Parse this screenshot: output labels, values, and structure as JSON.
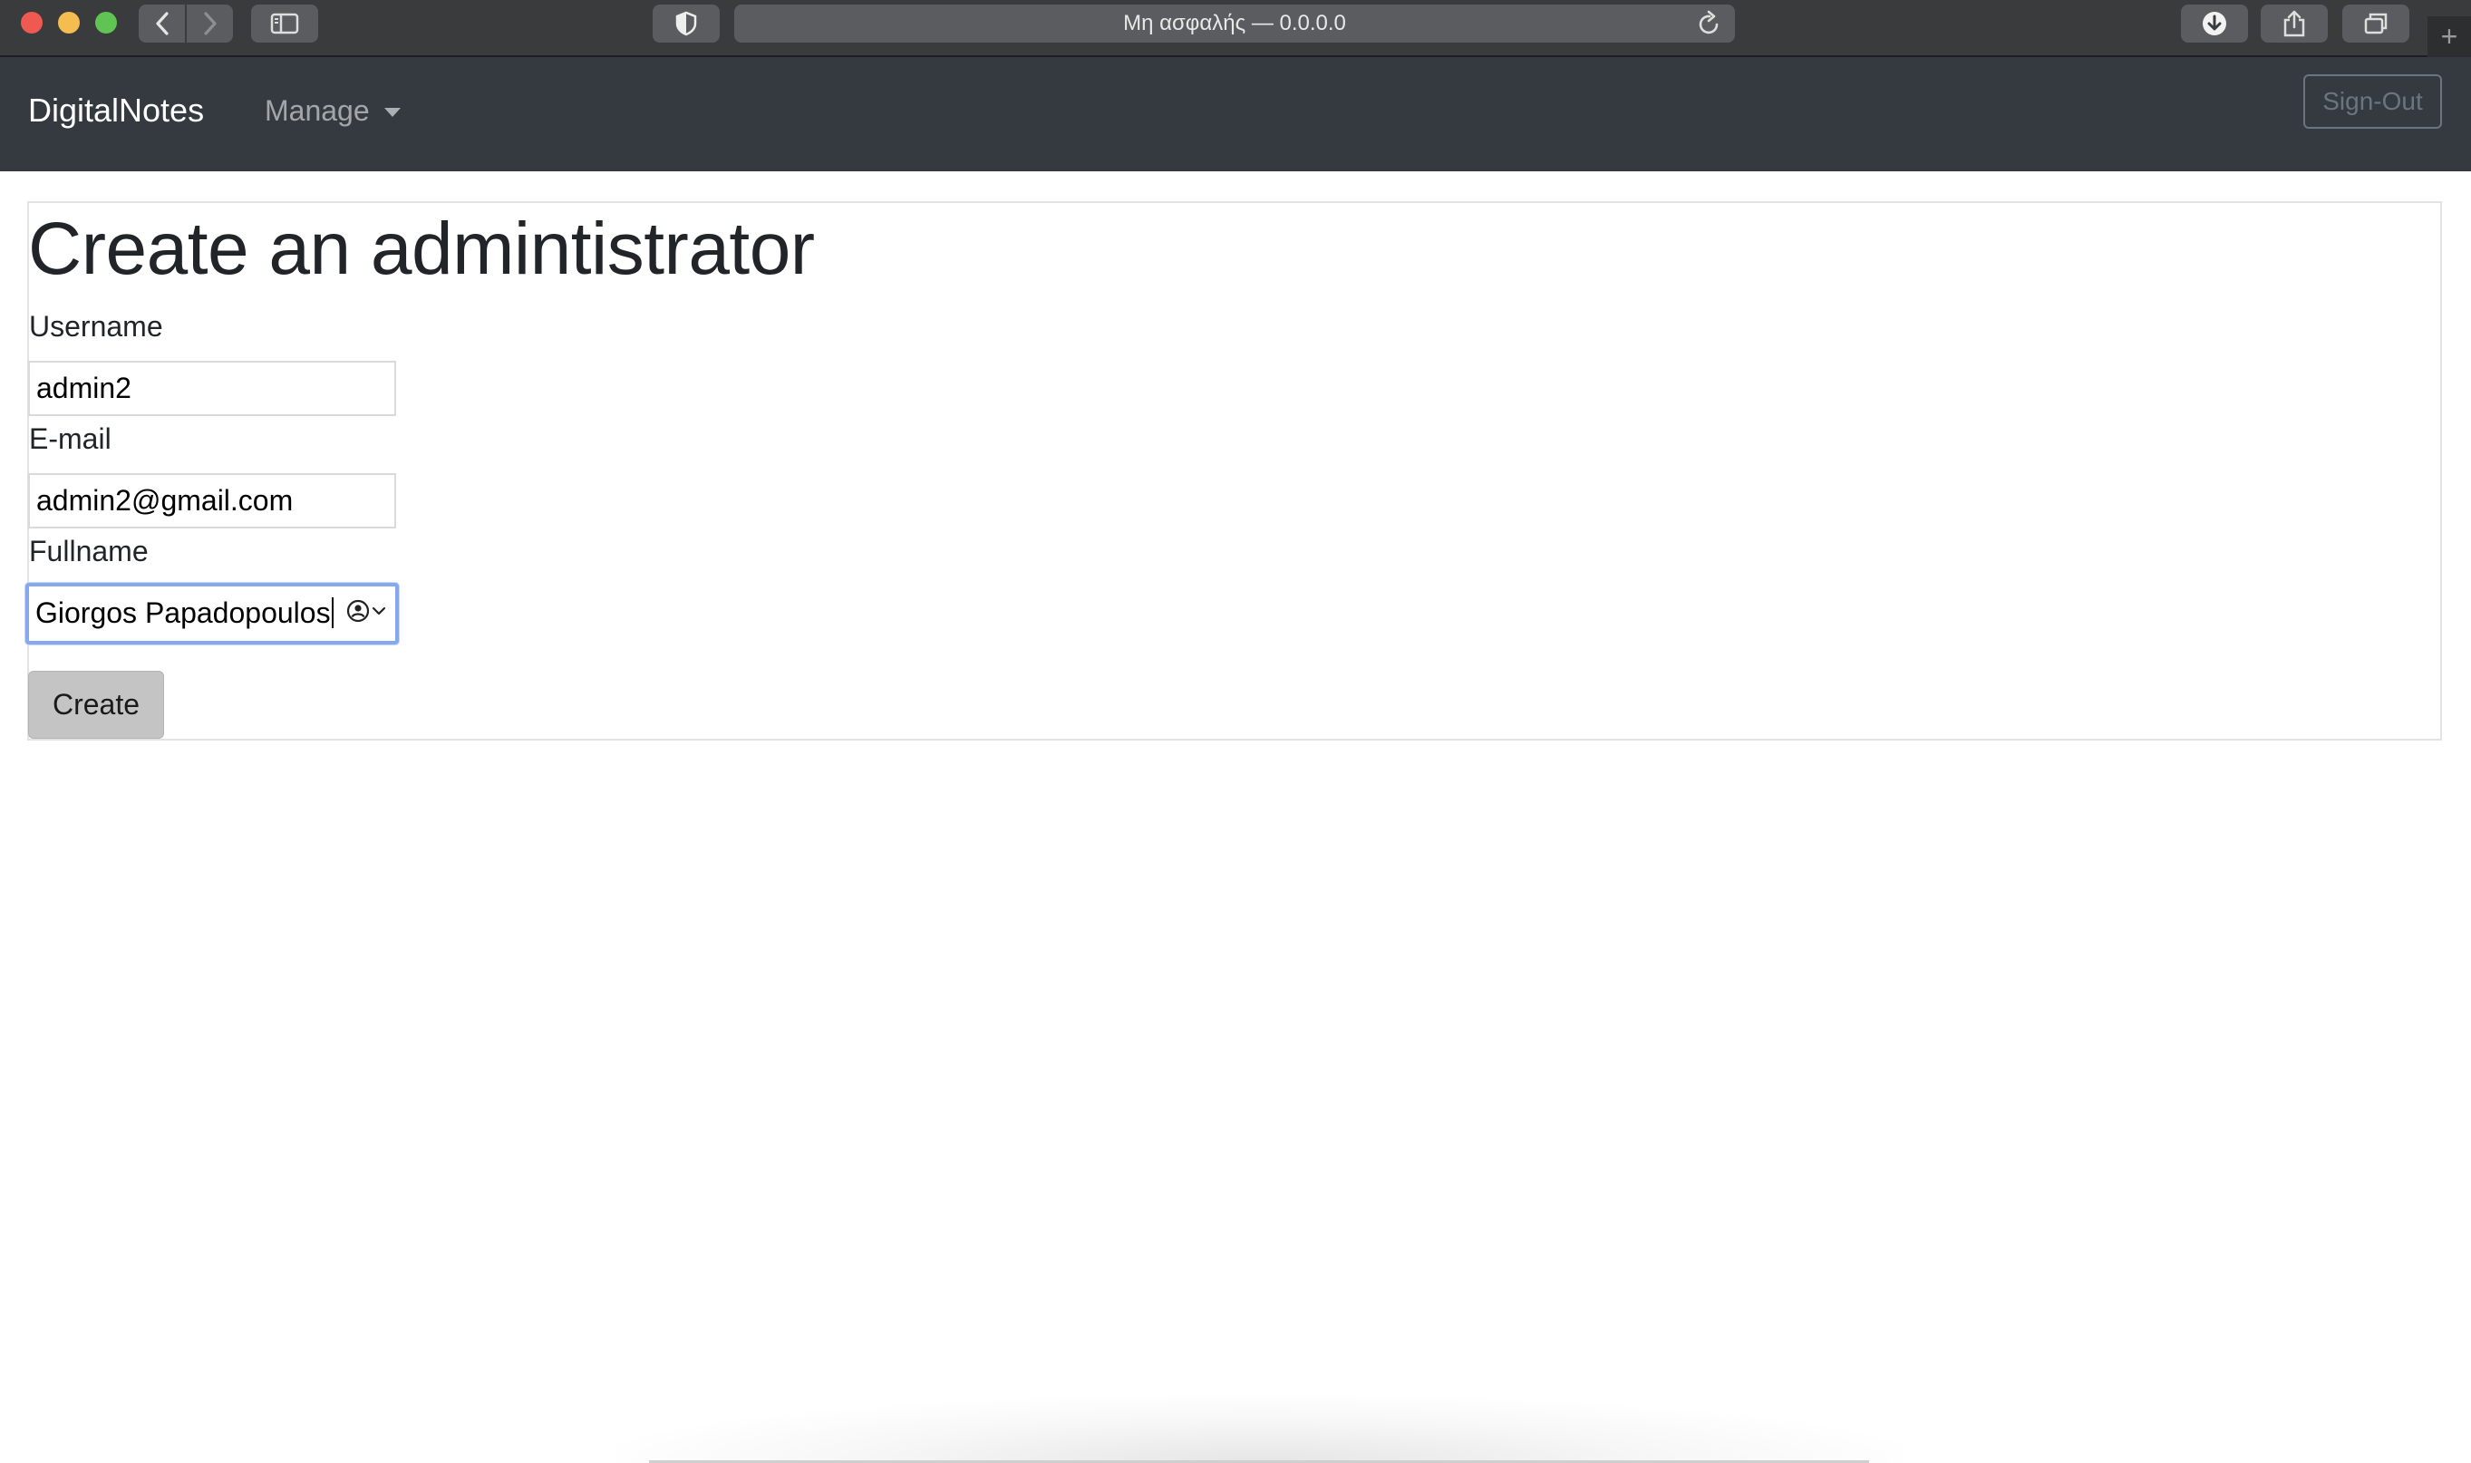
{
  "browser": {
    "address": "Μη ασφαλής — 0.0.0.0",
    "new_tab_symbol": "+",
    "icons": [
      "back-icon",
      "forward-icon",
      "sidebar-icon",
      "shield-icon",
      "reload-icon",
      "download-icon",
      "share-icon",
      "tabs-icon"
    ]
  },
  "navbar": {
    "brand": "DigitalNotes",
    "manage_label": "Manage",
    "signout_label": "Sign-Out"
  },
  "form": {
    "title": "Create an admintistrator",
    "username_label": "Username",
    "username_value": "admin2",
    "email_label": "E-mail",
    "email_value": "admin2@gmail.com",
    "fullname_label": "Fullname",
    "fullname_value": "Giorgos Papadopoulos",
    "create_label": "Create"
  },
  "colors": {
    "navbar_bg": "#343a40",
    "focus_ring": "#86a8ef",
    "button_bg": "#c4c4c4"
  }
}
